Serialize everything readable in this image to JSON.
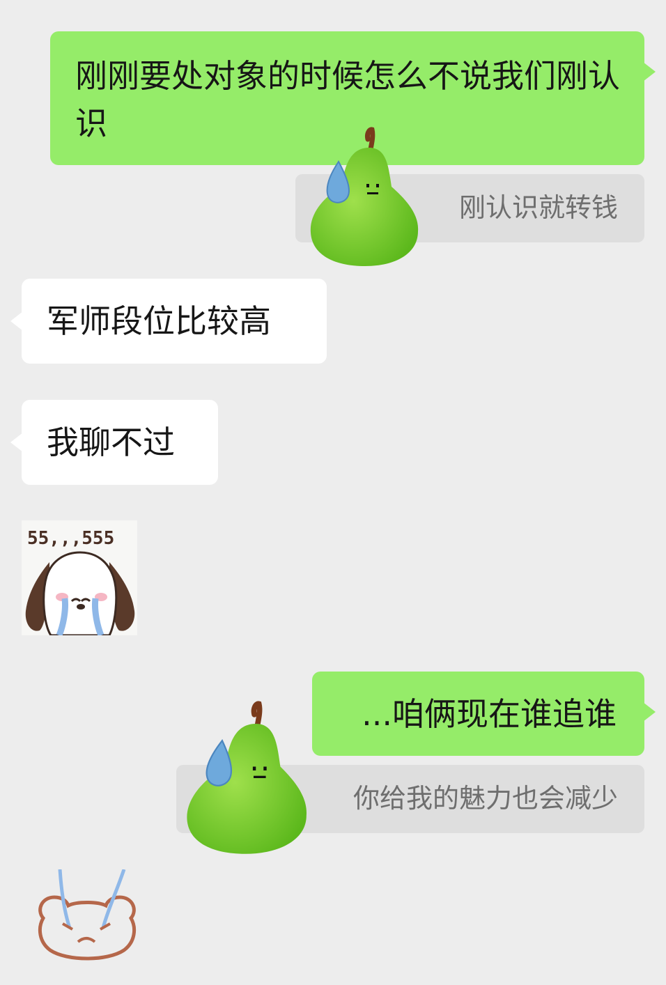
{
  "messages": [
    {
      "id": "m1",
      "side": "out",
      "text": "刚刚要处对象的时候怎么不说我们刚认识"
    },
    {
      "id": "q1",
      "type": "quote",
      "text": "刚认识就转钱"
    },
    {
      "id": "m2",
      "side": "in",
      "text": "军师段位比较高"
    },
    {
      "id": "m3",
      "side": "in",
      "text": "我聊不过"
    },
    {
      "id": "s1",
      "side": "in",
      "type": "sticker",
      "sticker_text": "55,,,555"
    },
    {
      "id": "m4",
      "side": "out",
      "text": "...咱俩现在谁追谁"
    },
    {
      "id": "q2",
      "type": "quote",
      "text": "你给我的魅力也会减少"
    },
    {
      "id": "s2",
      "side": "in",
      "type": "sticker"
    }
  ],
  "icons": {
    "pear_sticker": "pear-sweat-sticker",
    "crying_dog": "crying-dog-sticker",
    "crying_bear": "crying-bear-sticker"
  },
  "colors": {
    "background": "#ededed",
    "outgoing_bubble": "#95ec69",
    "incoming_bubble": "#ffffff",
    "quote_bg": "#dedede",
    "quote_text": "#6e6e6e"
  }
}
